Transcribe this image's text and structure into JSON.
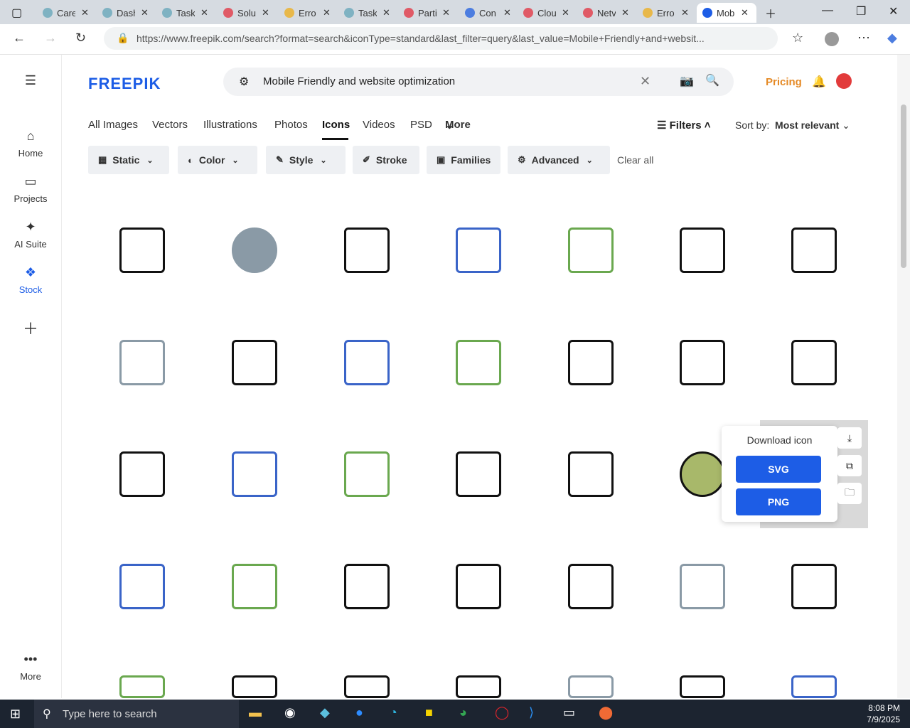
{
  "browser": {
    "tabs": [
      {
        "label": "Care",
        "color": "#7fb2c2"
      },
      {
        "label": "Dash",
        "color": "#7fb2c2"
      },
      {
        "label": "Task",
        "color": "#7fb2c2"
      },
      {
        "label": "Solu",
        "color": "#e05a66"
      },
      {
        "label": "Erro",
        "color": "#e8b84a"
      },
      {
        "label": "Task",
        "color": "#7fb2c2"
      },
      {
        "label": "Parti",
        "color": "#e05a66"
      },
      {
        "label": "Con",
        "color": "#4c7de0"
      },
      {
        "label": "Clou",
        "color": "#e05a66"
      },
      {
        "label": "Netv",
        "color": "#e05a66"
      },
      {
        "label": "Erro",
        "color": "#e8b84a"
      },
      {
        "label": "Mob",
        "color": "#1d5de6"
      }
    ],
    "url": "https://www.freepik.com/search?format=search&iconType=standard&last_filter=query&last_value=Mobile+Friendly+and+websit..."
  },
  "sidebar": {
    "items": [
      {
        "label": "Home",
        "icon": "home-icon"
      },
      {
        "label": "Projects",
        "icon": "projects-icon"
      },
      {
        "label": "AI Suite",
        "icon": "ai-suite-icon"
      },
      {
        "label": "Stock",
        "icon": "stock-icon"
      }
    ],
    "more_label": "More"
  },
  "header": {
    "logo": "FREEPIK",
    "search_query": "Mobile Friendly and website optimization",
    "pricing_label": "Pricing"
  },
  "type_tabs": [
    "All Images",
    "Vectors",
    "Illustrations",
    "Photos",
    "Icons",
    "Videos",
    "PSD",
    "More"
  ],
  "filters_label": "Filters",
  "sort": {
    "label": "Sort by:",
    "value": "Most relevant"
  },
  "filter_buttons": [
    "Static",
    "Color",
    "Style",
    "Stroke",
    "Families",
    "Advanced"
  ],
  "clear_all": "Clear all",
  "download_popup": {
    "title": "Download icon",
    "svg_label": "SVG",
    "png_label": "PNG"
  },
  "taskbar": {
    "search_placeholder": "Type here to search",
    "time": "8:08 PM",
    "date": "7/9/2025"
  }
}
